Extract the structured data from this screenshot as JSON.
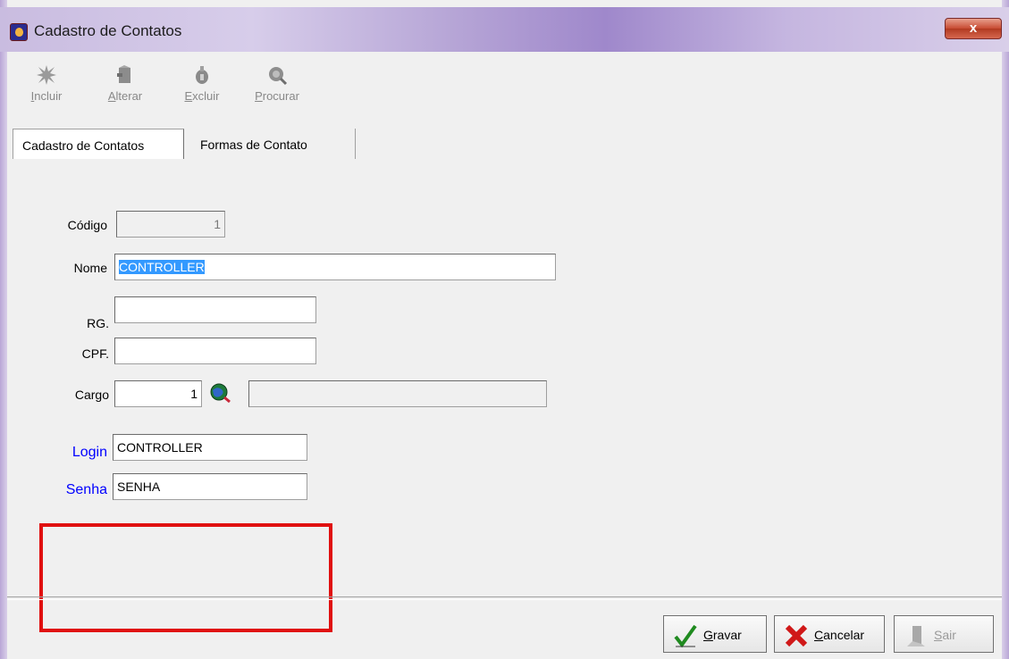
{
  "window": {
    "title": "Cadastro de Contatos",
    "close_label": "x"
  },
  "toolbar": [
    {
      "label": "Incluir",
      "icon": "spark-icon"
    },
    {
      "label": "Alterar",
      "icon": "edit-icon"
    },
    {
      "label": "Excluir",
      "icon": "delete-icon"
    },
    {
      "label": "Procurar",
      "icon": "search-icon"
    }
  ],
  "tabs": [
    {
      "label": "Cadastro de Contatos",
      "active": true
    },
    {
      "label": "Formas de Contato",
      "active": false
    }
  ],
  "form": {
    "codigo": {
      "label": "Código",
      "value": "1"
    },
    "nome": {
      "label": "Nome",
      "value": "CONTROLLER"
    },
    "rg": {
      "label": "RG.",
      "value": ""
    },
    "cpf": {
      "label": "CPF.",
      "value": ""
    },
    "cargo": {
      "label": "Cargo",
      "value": "1",
      "description": ""
    },
    "login": {
      "label": "Login",
      "value": "CONTROLLER"
    },
    "senha": {
      "label": "Senha",
      "value": "SENHA"
    }
  },
  "buttons": {
    "gravar": "Gravar",
    "cancelar": "Cancelar",
    "sair": "Sair"
  },
  "colors": {
    "highlight": "#e01010",
    "label_blue": "#0000ff",
    "selection": "#3399ff"
  }
}
